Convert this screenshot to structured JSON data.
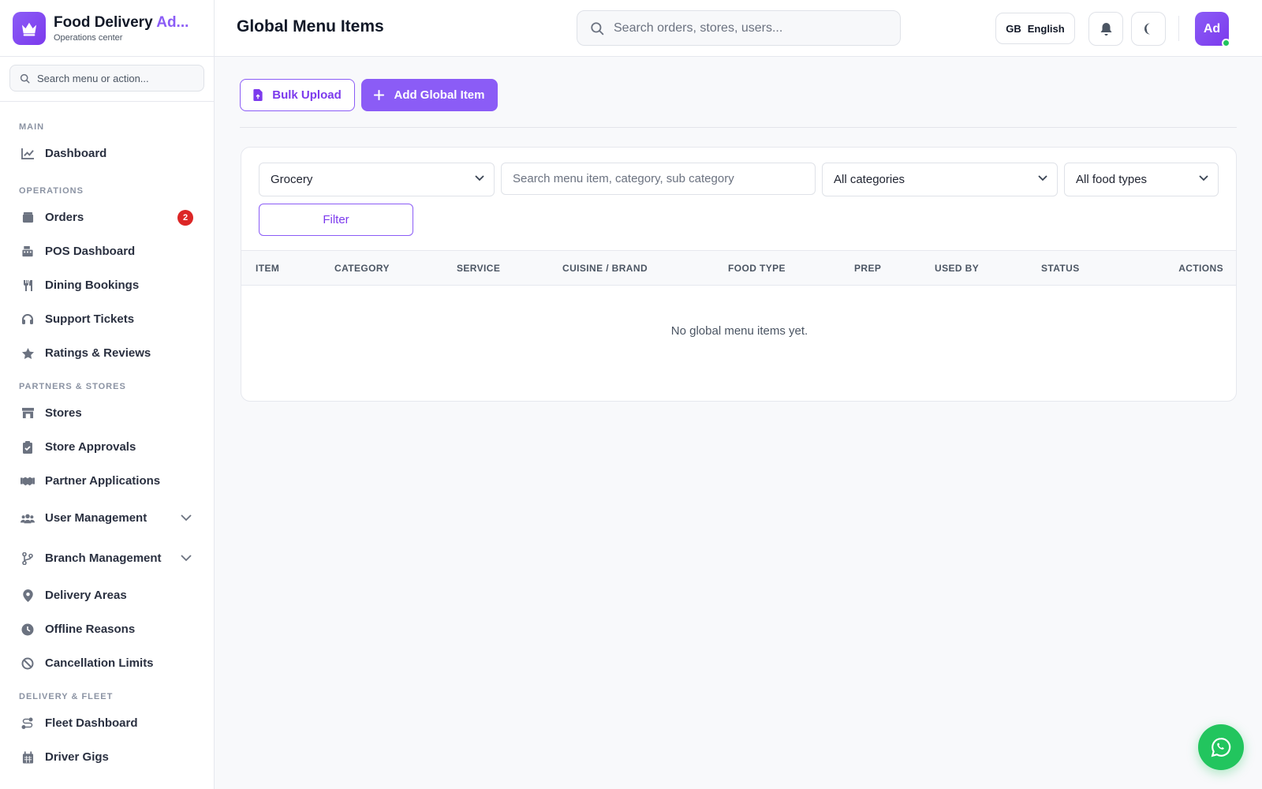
{
  "brand": {
    "title_main": "Food Delivery ",
    "title_accent": "Ad...",
    "subtitle": "Operations center",
    "logo_icon": "crown-icon"
  },
  "sidebar": {
    "search_placeholder": "Search menu or action...",
    "sections": {
      "main": "MAIN",
      "operations": "OPERATIONS",
      "partners": "PARTNERS & STORES",
      "delivery": "DELIVERY & FLEET"
    },
    "items": [
      {
        "label": "Dashboard",
        "icon": "chart-line-icon"
      },
      {
        "label": "Orders",
        "icon": "box-icon",
        "badge": "2"
      },
      {
        "label": "POS Dashboard",
        "icon": "cash-register-icon"
      },
      {
        "label": "Dining Bookings",
        "icon": "utensils-icon"
      },
      {
        "label": "Support Tickets",
        "icon": "headset-icon"
      },
      {
        "label": "Ratings & Reviews",
        "icon": "star-icon"
      },
      {
        "label": "Stores",
        "icon": "store-icon"
      },
      {
        "label": "Store Approvals",
        "icon": "clipboard-check-icon"
      },
      {
        "label": "Partner Applications",
        "icon": "handshake-icon"
      },
      {
        "label": "User Management",
        "icon": "users-icon"
      },
      {
        "label": "Branch Management",
        "icon": "code-branch-icon"
      },
      {
        "label": "Delivery Areas",
        "icon": "map-pin-icon"
      },
      {
        "label": "Offline Reasons",
        "icon": "clock-icon"
      },
      {
        "label": "Cancellation Limits",
        "icon": "ban-icon"
      },
      {
        "label": "Fleet Dashboard",
        "icon": "route-icon"
      },
      {
        "label": "Driver Gigs",
        "icon": "calendar-icon"
      }
    ]
  },
  "header": {
    "title": "Global Menu Items",
    "search_placeholder": "Search orders, stores, users...",
    "lang_code": "GB",
    "lang_label": "English",
    "avatar_initials": "Ad"
  },
  "toolbar": {
    "bulk_upload": "Bulk Upload",
    "add_global": "Add Global Item"
  },
  "filters": {
    "service_value": "Grocery",
    "search_placeholder": "Search menu item, category, sub category",
    "category_value": "All categories",
    "food_type_value": "All food types",
    "filter_button": "Filter"
  },
  "table": {
    "columns": [
      "ITEM",
      "CATEGORY",
      "SERVICE",
      "CUISINE / BRAND",
      "FOOD TYPE",
      "PREP",
      "USED BY",
      "STATUS",
      "ACTIONS"
    ],
    "rows": [],
    "empty_message": "No global menu items yet."
  },
  "colors": {
    "accent": "#8b5cf6",
    "badge": "#dc2626",
    "online": "#22c55e",
    "fab": "#22c55e"
  }
}
